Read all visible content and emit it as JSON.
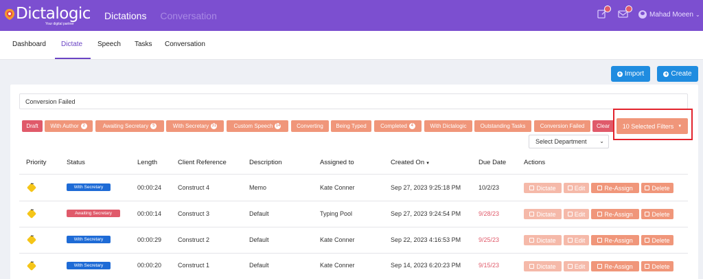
{
  "app": {
    "logo_text": "Dictalogic",
    "logo_tagline": "Your digital partner",
    "top_nav": [
      "Dictations",
      "Conversation"
    ],
    "user_name": "Mahad Moeen"
  },
  "subnav": {
    "tabs": [
      "Dashboard",
      "Dictate",
      "Speech",
      "Tasks",
      "Conversation"
    ],
    "active": "Dictate"
  },
  "actions": {
    "import_label": "Import",
    "create_label": "Create"
  },
  "search": {
    "value": "Conversion Failed"
  },
  "filters": {
    "chips": [
      {
        "label": "Draft",
        "count": ""
      },
      {
        "label": "With Author",
        "count": "2"
      },
      {
        "label": "Awaiting Secretary",
        "count": "5"
      },
      {
        "label": "With Secretary",
        "count": "31"
      },
      {
        "label": "Custom Speech",
        "count": "14"
      },
      {
        "label": "Converting",
        "count": ""
      },
      {
        "label": "Being Typed",
        "count": ""
      },
      {
        "label": "Completed",
        "count": "4"
      },
      {
        "label": "With Dictalogic",
        "count": ""
      },
      {
        "label": "Outstanding Tasks",
        "count": ""
      },
      {
        "label": "Conversion Failed",
        "count": ""
      }
    ],
    "clear_label": "Clear",
    "selected_label": "10 Selected Filters",
    "department_placeholder": "Select Department"
  },
  "table": {
    "headers": [
      "Priority",
      "Status",
      "Length",
      "Client Reference",
      "Description",
      "Assigned to",
      "Created On",
      "Due Date",
      "Actions"
    ],
    "rows": [
      {
        "status": "With Secretary",
        "length": "00:00:24",
        "client": "Construct 4",
        "desc": "Memo",
        "assigned": "Kate Conner",
        "created": "Sep 27, 2023 9:25:18 PM",
        "due": "10/2/23"
      },
      {
        "status": "Awaiting Secretary",
        "length": "00:00:14",
        "client": "Construct 3",
        "desc": "Default",
        "assigned": "Typing Pool",
        "created": "Sep 27, 2023 9:24:54 PM",
        "due": "9/28/23"
      },
      {
        "status": "With Secretary",
        "length": "00:00:29",
        "client": "Construct 2",
        "desc": "Default",
        "assigned": "Kate Conner",
        "created": "Sep 22, 2023 4:16:53 PM",
        "due": "9/25/23"
      },
      {
        "status": "With Secretary",
        "length": "00:00:20",
        "client": "Construct 1",
        "desc": "Default",
        "assigned": "Kate Conner",
        "created": "Sep 14, 2023 6:20:23 PM",
        "due": "9/15/23"
      }
    ],
    "action_labels": {
      "dictate": "Dictate",
      "edit": "Edit",
      "reassign": "Re-Assign",
      "delete": "Delete"
    }
  },
  "colors": {
    "brand": "#7c4fd0",
    "chip": "#f0967a",
    "danger": "#e05a6a",
    "primary": "#1f8ce0",
    "status_secretary": "#1e6bd6"
  }
}
